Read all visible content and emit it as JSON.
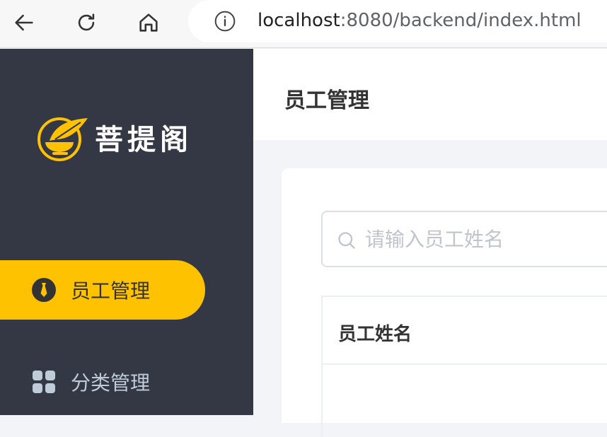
{
  "browser": {
    "url_host": "localhost",
    "url_rest": ":8080/backend/index.html",
    "icons": [
      "back-arrow-icon",
      "reload-icon",
      "home-icon",
      "info-icon"
    ]
  },
  "sidebar": {
    "logo_text": "菩提阁",
    "items": [
      {
        "label": "员工管理",
        "icon": "necktie-icon",
        "active": true
      },
      {
        "label": "分类管理",
        "icon": "grid-icon",
        "active": false
      }
    ]
  },
  "header": {
    "title": "员工管理"
  },
  "search": {
    "placeholder": "请输入员工姓名",
    "value": ""
  },
  "table": {
    "columns": [
      "员工姓名"
    ]
  },
  "colors": {
    "accent": "#ffc200",
    "sidebar_bg": "#343744",
    "inactive_text": "#bfcbd9"
  }
}
